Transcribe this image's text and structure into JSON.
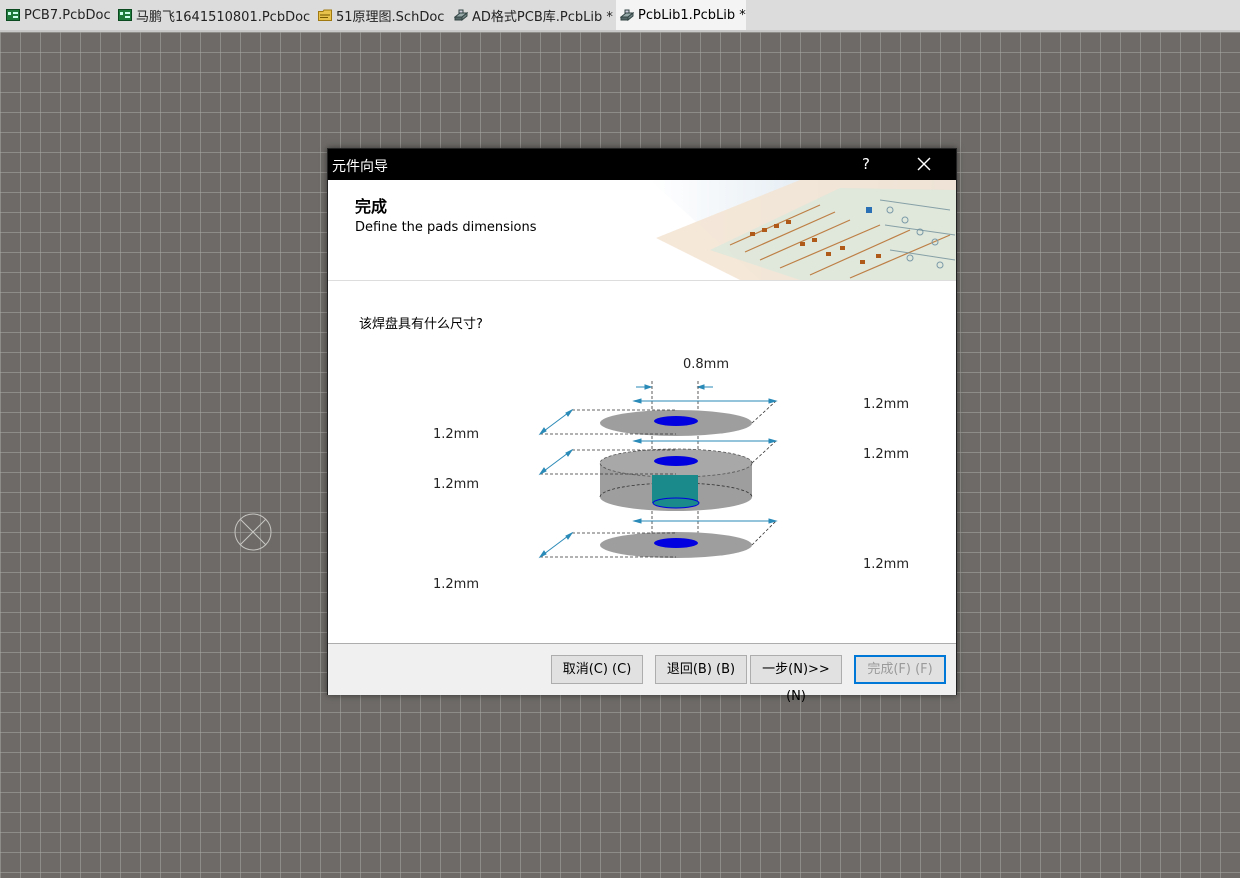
{
  "tabs": [
    {
      "label": "PCB7.PcbDoc",
      "icon": "pcb-doc-icon",
      "active": false
    },
    {
      "label": "马鹏飞1641510801.PcbDoc",
      "icon": "pcb-doc-icon",
      "active": false
    },
    {
      "label": "51原理图.SchDoc",
      "icon": "sch-doc-icon",
      "active": false
    },
    {
      "label": "AD格式PCB库.PcbLib *",
      "icon": "pcb-lib-icon",
      "active": false
    },
    {
      "label": "PcbLib1.PcbLib *",
      "icon": "pcb-lib-icon",
      "active": true
    }
  ],
  "dialog": {
    "title": "元件向导",
    "help": "?",
    "header_title": "完成",
    "header_subtitle": "Define the pads dimensions",
    "question": "该焊盘具有什么尺寸?",
    "dims": {
      "hole": "0.8mm",
      "left_top": "1.2mm",
      "left_mid": "1.2mm",
      "left_bottom": "1.2mm",
      "right_top": "1.2mm",
      "right_mid": "1.2mm",
      "right_bottom": "1.2mm"
    },
    "buttons": {
      "cancel": "取消(C) (C)",
      "back": "退回(B) (B)",
      "next": "一步(N)>> (N)",
      "finish": "完成(F) (F)"
    }
  },
  "colors": {
    "canvas": "#6d6a67",
    "grid": "#a9a7a4",
    "pad_gray": "#9e9e9e",
    "hole_blue": "#0000e0",
    "barrel_teal": "#1a8a8a",
    "arrow_blue": "#2a8ab8",
    "focus_blue": "#0078d7"
  }
}
